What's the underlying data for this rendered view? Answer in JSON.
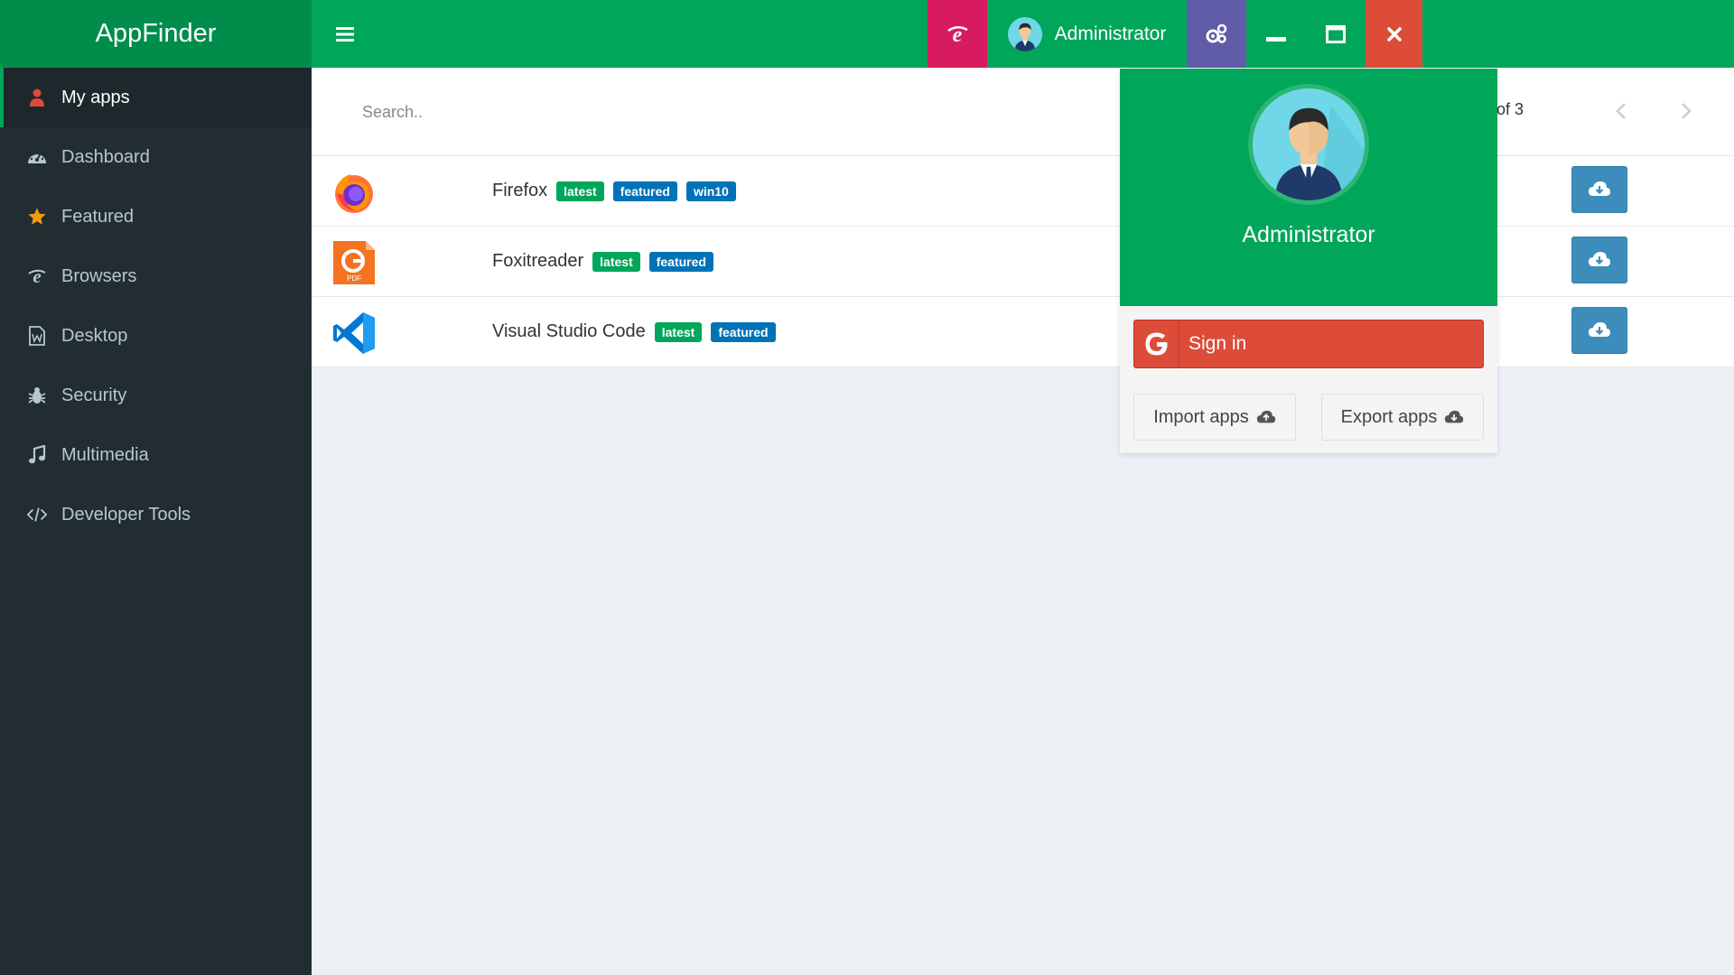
{
  "app": {
    "brand": "AppFinder"
  },
  "header": {
    "user_name": "Administrator",
    "colors": {
      "brand": "#008d4c",
      "bar": "#00a65a",
      "ie": "#d81b60",
      "settings": "#605ca8",
      "close": "#dd4b39"
    }
  },
  "sidebar": {
    "items": [
      {
        "label": "My apps",
        "icon": "user-icon",
        "active": true
      },
      {
        "label": "Dashboard",
        "icon": "dashboard-icon"
      },
      {
        "label": "Featured",
        "icon": "star-icon"
      },
      {
        "label": "Browsers",
        "icon": "internet-explorer-icon"
      },
      {
        "label": "Desktop",
        "icon": "document-icon"
      },
      {
        "label": "Security",
        "icon": "bug-icon"
      },
      {
        "label": "Multimedia",
        "icon": "music-icon"
      },
      {
        "label": "Developer Tools",
        "icon": "code-icon"
      }
    ]
  },
  "search": {
    "placeholder": "Search.."
  },
  "pager": {
    "text": "of 3"
  },
  "apps": [
    {
      "name": "Firefox",
      "icon": "firefox-icon",
      "badges": [
        "latest",
        "featured",
        "win10"
      ]
    },
    {
      "name": "Foxitreader",
      "icon": "foxitreader-icon",
      "badges": [
        "latest",
        "featured"
      ]
    },
    {
      "name": "Visual Studio Code",
      "icon": "vscode-icon",
      "badges": [
        "latest",
        "featured"
      ]
    }
  ],
  "dropdown": {
    "user_name": "Administrator",
    "signin_label": "Sign in",
    "import_label": "Import apps",
    "export_label": "Export apps"
  }
}
